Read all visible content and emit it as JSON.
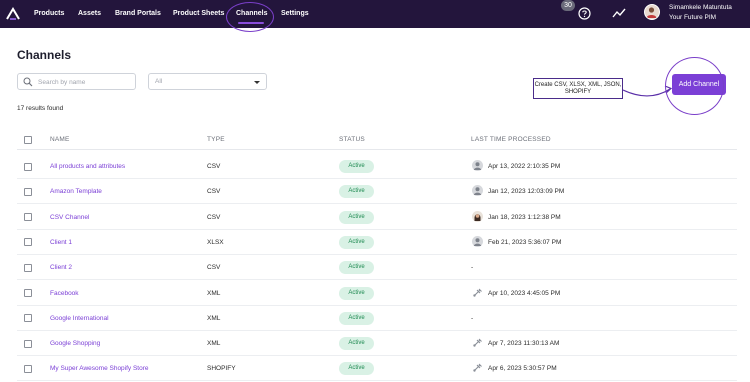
{
  "nav": {
    "items": [
      "Products",
      "Assets",
      "Brand Portals",
      "Product Sheets",
      "Channels",
      "Settings"
    ],
    "active": "Channels",
    "notification_count": "30",
    "user_name": "Simamkele Matuntuta",
    "user_org": "Your Future PIM"
  },
  "page": {
    "title": "Channels",
    "search_placeholder": "Search by name",
    "filter_value": "All",
    "results_text": "17 results found",
    "add_button": "Add Channel",
    "annotation": "Create CSV, XLSX, XML, JSON, SHOPIFY"
  },
  "table": {
    "headers": [
      "NAME",
      "TYPE",
      "STATUS",
      "LAST TIME PROCESSED"
    ],
    "rows": [
      {
        "name": "All products and attributes",
        "type": "CSV",
        "status": "Active",
        "last": "Apr 13, 2022 2:10:35 PM",
        "icon": "avatar-gray-icon"
      },
      {
        "name": "Amazon Template",
        "type": "CSV",
        "status": "Active",
        "last": "Jan 12, 2023 12:03:09 PM",
        "icon": "avatar-gray-icon"
      },
      {
        "name": "CSV Channel",
        "type": "CSV",
        "status": "Active",
        "last": "Jan 18, 2023 1:12:38 PM",
        "icon": "avatar-woman-icon"
      },
      {
        "name": "Client 1",
        "type": "XLSX",
        "status": "Active",
        "last": "Feb 21, 2023 5:36:07 PM",
        "icon": "avatar-gray-icon"
      },
      {
        "name": "Client 2",
        "type": "CSV",
        "status": "Active",
        "last": "-",
        "icon": ""
      },
      {
        "name": "Facebook",
        "type": "XML",
        "status": "Active",
        "last": "Apr 10, 2023 4:45:05 PM",
        "icon": "robot-icon"
      },
      {
        "name": "Google International",
        "type": "XML",
        "status": "Active",
        "last": "-",
        "icon": ""
      },
      {
        "name": "Google Shopping",
        "type": "XML",
        "status": "Active",
        "last": "Apr 7, 2023 11:30:13 AM",
        "icon": "robot-icon"
      },
      {
        "name": "My Super Awesome Shopify Store",
        "type": "SHOPIFY",
        "status": "Active",
        "last": "Apr 6, 2023 5:30:57 PM",
        "icon": "robot-icon"
      }
    ]
  },
  "colors": {
    "topbar": "#23153c",
    "accent": "#7b3fd6",
    "status_bg": "#d9f1e5",
    "status_text": "#1f8a52"
  }
}
